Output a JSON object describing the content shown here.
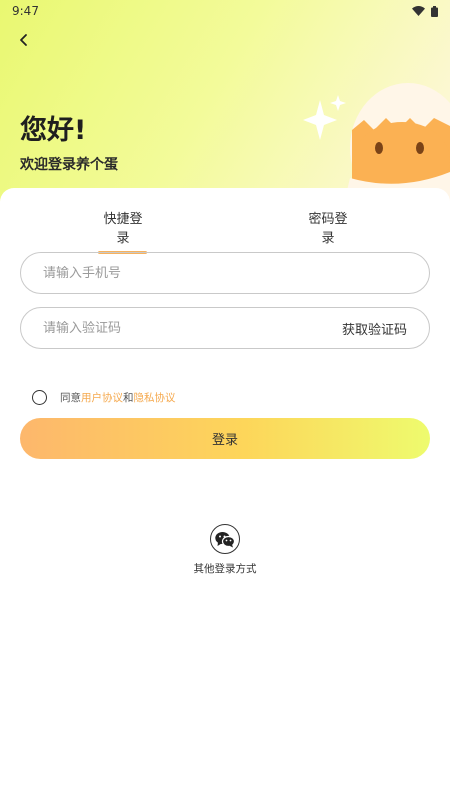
{
  "status_bar": {
    "time": "9:47"
  },
  "header": {
    "greeting": "您好!",
    "welcome": "欢迎登录养个蛋"
  },
  "tabs": [
    {
      "label": "快捷登录",
      "active": true
    },
    {
      "label": "密码登录",
      "active": false
    }
  ],
  "form": {
    "phone_placeholder": "请输入手机号",
    "phone_value": "",
    "code_placeholder": "请输入验证码",
    "code_value": "",
    "get_code_label": "获取验证码"
  },
  "agreement": {
    "checked": false,
    "prefix": "同意",
    "user_agreement": "用户协议",
    "and": "和",
    "privacy_agreement": "隐私协议"
  },
  "login_button": "登录",
  "other_login": {
    "label": "其他登录方式",
    "icon": "wechat-icon"
  },
  "colors": {
    "accent": "#f7b25e",
    "link": "#f5a94e",
    "hero_start": "#e9f871",
    "button_start": "#fdb76c",
    "button_end": "#eefb6e"
  }
}
